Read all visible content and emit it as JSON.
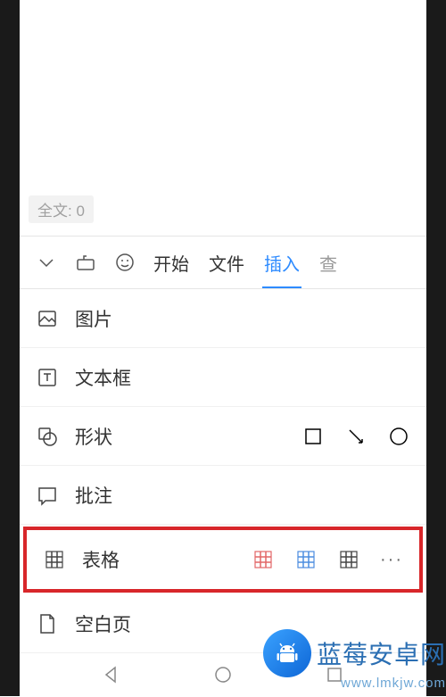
{
  "word_count": {
    "label": "全文: ",
    "value": 0
  },
  "toolbar": {
    "tabs": {
      "start": "开始",
      "file": "文件",
      "insert": "插入",
      "partial": "查"
    }
  },
  "menu": {
    "image": "图片",
    "textbox": "文本框",
    "shape": "形状",
    "comment": "批注",
    "table": "表格",
    "blank_page": "空白页"
  },
  "table_options": {
    "red": "#e26667",
    "blue": "#4c8de0",
    "black": "#444444"
  },
  "watermark": {
    "title": "蓝莓安卓网",
    "subtitle": "www.lmkjw.com"
  }
}
